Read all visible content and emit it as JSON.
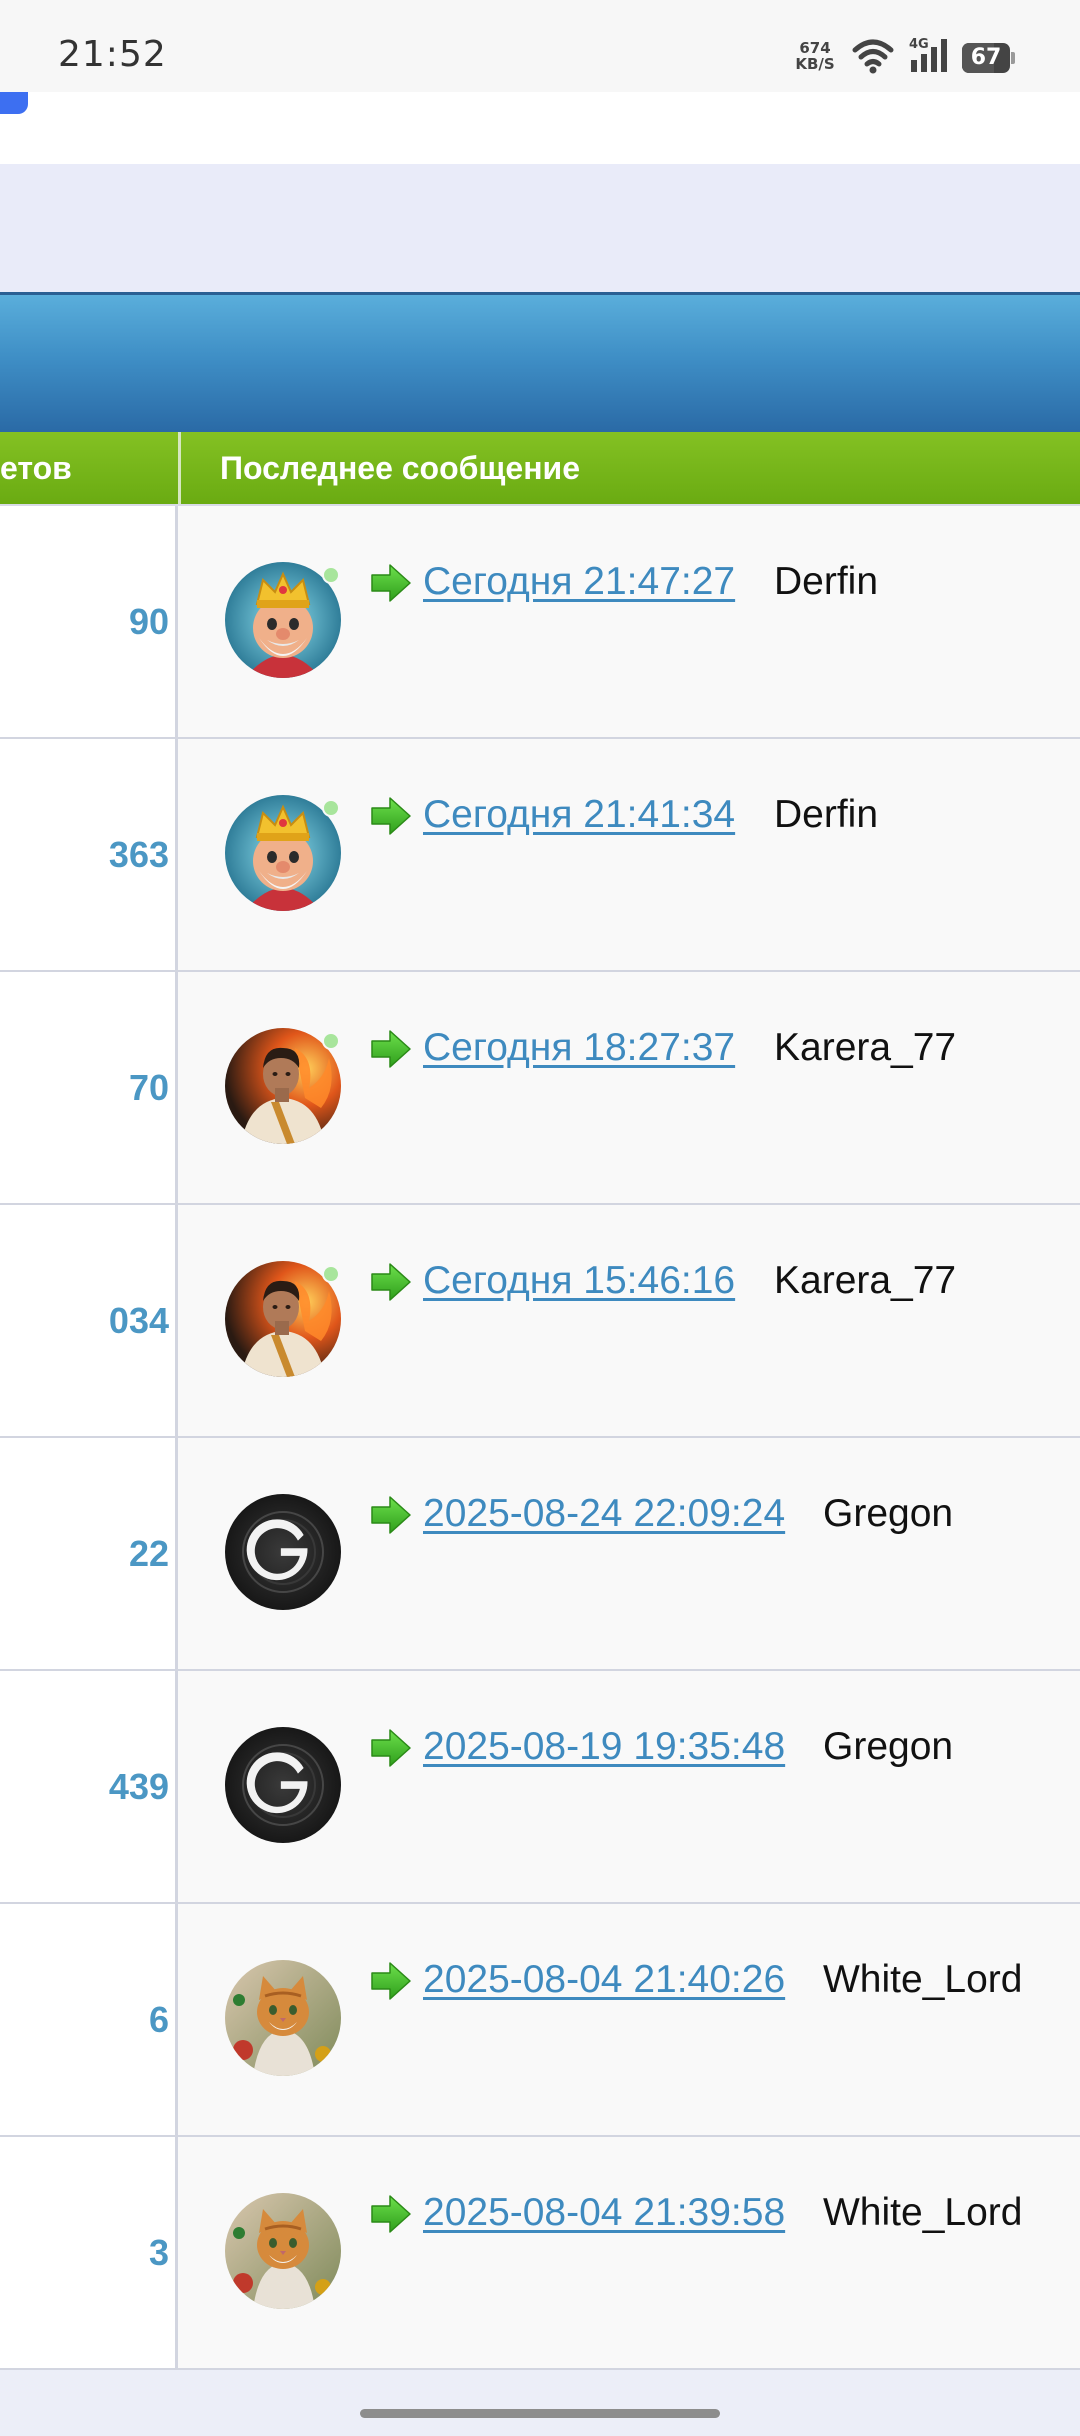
{
  "status_bar": {
    "time": "21:52",
    "net_speed_value": "674",
    "net_speed_unit": "KB/S",
    "network_type": "4G",
    "battery": "67"
  },
  "table": {
    "headers": {
      "replies": "етов",
      "last_post": "Последнее сообщение"
    },
    "rows": [
      {
        "replies": "90",
        "time": "Сегодня 21:47:27",
        "author": "Derfin",
        "avatar": "king-avatar"
      },
      {
        "replies": "363",
        "time": "Сегодня 21:41:34",
        "author": "Derfin",
        "avatar": "king-avatar"
      },
      {
        "replies": "70",
        "time": "Сегодня 18:27:37",
        "author": "Karera_77",
        "avatar": "man-fire-avatar"
      },
      {
        "replies": "034",
        "time": "Сегодня 15:46:16",
        "author": "Karera_77",
        "avatar": "man-fire-avatar"
      },
      {
        "replies": "22",
        "time": "2025-08-24 22:09:24",
        "author": "Gregon",
        "avatar": "g-logo-avatar"
      },
      {
        "replies": "439",
        "time": "2025-08-19 19:35:48",
        "author": "Gregon",
        "avatar": "g-logo-avatar"
      },
      {
        "replies": "6",
        "time": "2025-08-04 21:40:26",
        "author": "White_Lord",
        "avatar": "cat-avatar"
      },
      {
        "replies": "3",
        "time": "2025-08-04 21:39:58",
        "author": "White_Lord",
        "avatar": "cat-avatar"
      }
    ]
  },
  "colors": {
    "link": "#3e8abf",
    "count": "#4b97c4",
    "header_green": "#6aab12",
    "banner_blue": "#3f8fc6",
    "status_online": "#a8e59c"
  }
}
